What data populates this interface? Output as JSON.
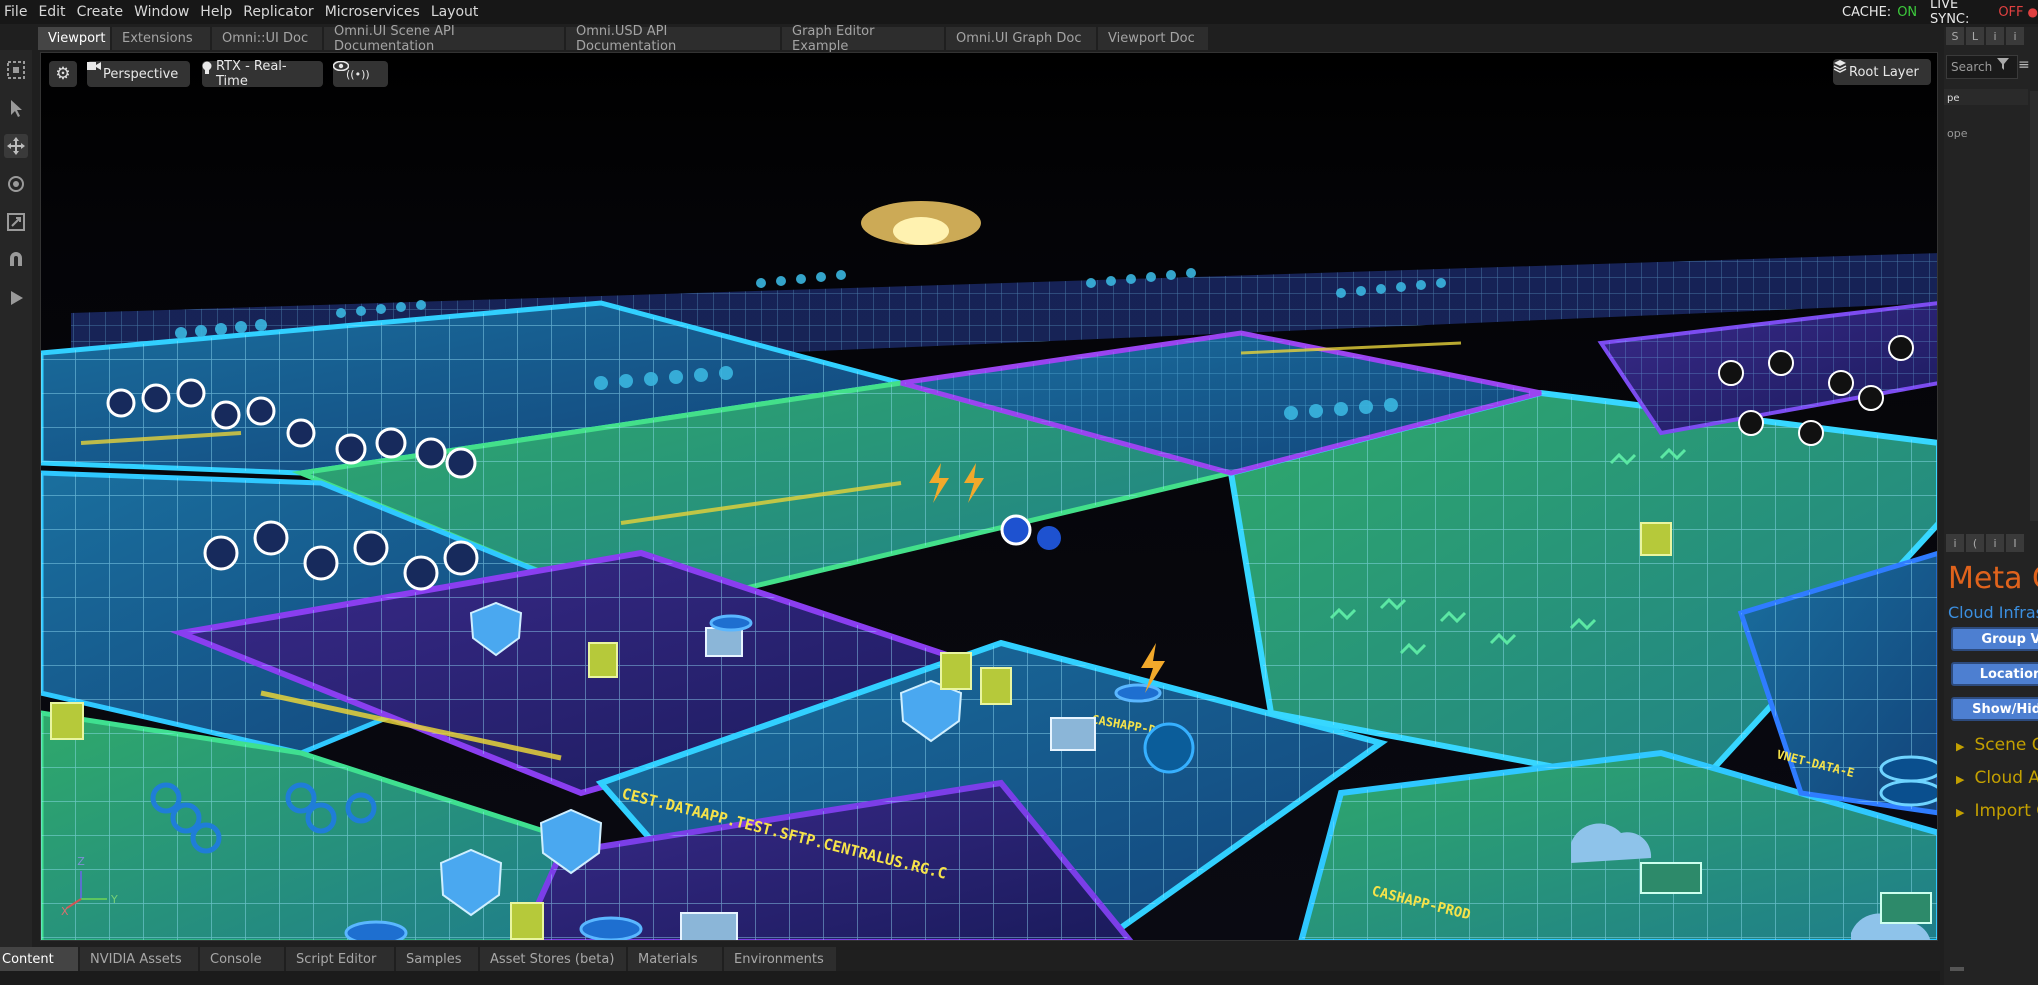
{
  "menu": [
    "File",
    "Edit",
    "Create",
    "Window",
    "Help",
    "Replicator",
    "Microservices",
    "Layout"
  ],
  "status": {
    "cache_label": "CACHE:",
    "cache_value": "ON",
    "live_sync_label": "LIVE SYNC:",
    "live_sync_value": "OFF",
    "on_color": "#3cc93c",
    "off_color": "#e04040"
  },
  "tabs": [
    "Viewport",
    "Extensions",
    "Omni::UI Doc",
    "Omni.UI Scene API Documentation",
    "Omni.USD API Documentation",
    "Graph Editor Example",
    "Omni.UI Graph Doc",
    "Viewport Doc"
  ],
  "active_tab": "Viewport",
  "viewport": {
    "camera_label": "Perspective",
    "render_label": "RTX - Real-Time",
    "layer_label": "Root Layer",
    "gizmo": {
      "z": "Z",
      "x": "X",
      "y": "Y"
    },
    "region_labels": [
      "CEST.DATAAPP.TEST.SFTP.CENTRALUS.RG.C",
      "CASHAPP-PROD",
      "CASHAPP-DEV",
      "VNET-DATA-E"
    ]
  },
  "bottom_tabs": [
    "Content",
    "NVIDIA Assets",
    "Console",
    "Script Editor",
    "Samples",
    "Asset Stores (beta)",
    "Materials",
    "Environments"
  ],
  "active_bottom_tab": "Content",
  "right_panel": {
    "search_placeholder": "Search",
    "list_items": [
      "pe",
      "ope"
    ],
    "title": "Meta C",
    "subtitle": "Cloud Infrast",
    "buttons": [
      "Group V",
      "Location",
      "Show/Hide"
    ],
    "sections": [
      "Scene C",
      "Cloud A",
      "Import C"
    ],
    "title_color": "#e0631c",
    "subtitle_color": "#3b8fe0"
  }
}
